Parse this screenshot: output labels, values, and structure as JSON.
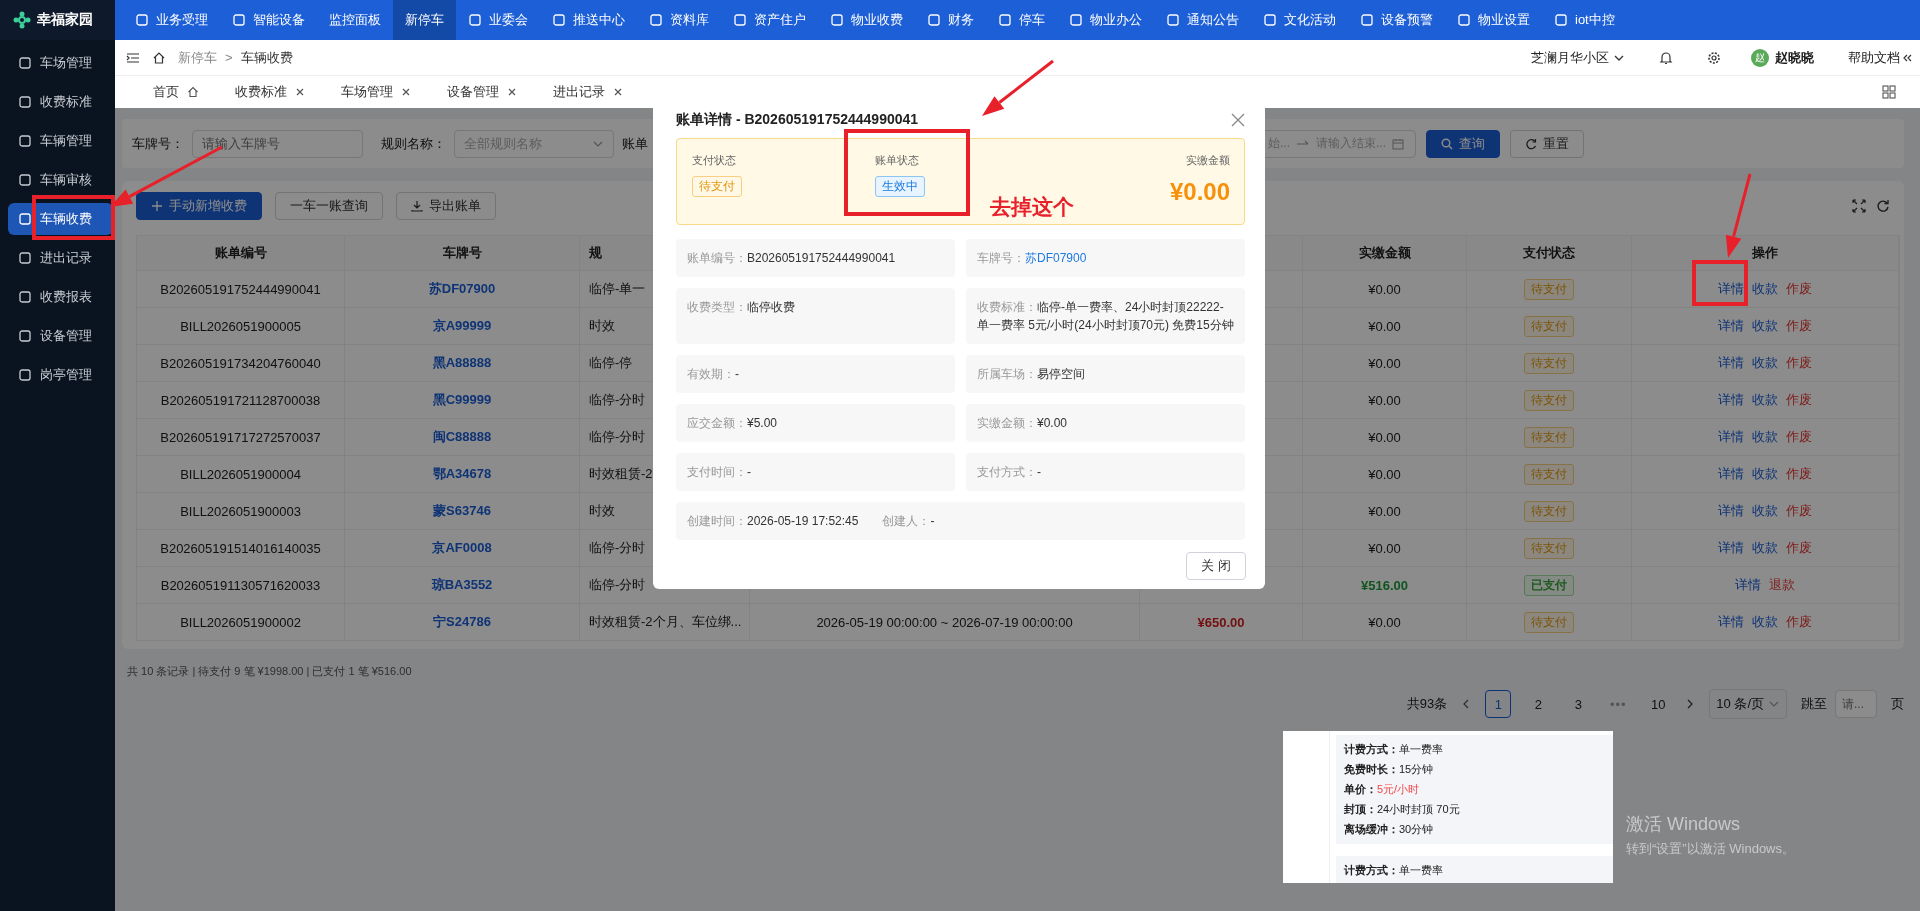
{
  "topbar": {
    "logo": "幸福家园",
    "nav": [
      {
        "label": "业务受理",
        "icon": true,
        "selected": false
      },
      {
        "label": "智能设备",
        "icon": true,
        "selected": false
      },
      {
        "label": "监控面板",
        "icon": false,
        "selected": false
      },
      {
        "label": "新停车",
        "icon": false,
        "selected": true
      },
      {
        "label": "业委会",
        "icon": true,
        "selected": false
      },
      {
        "label": "推送中心",
        "icon": true,
        "selected": false
      },
      {
        "label": "资料库",
        "icon": true,
        "selected": false
      },
      {
        "label": "资产住户",
        "icon": true,
        "selected": false
      },
      {
        "label": "物业收费",
        "icon": true,
        "selected": false
      },
      {
        "label": "财务",
        "icon": true,
        "selected": false
      },
      {
        "label": "停车",
        "icon": true,
        "selected": false
      },
      {
        "label": "物业办公",
        "icon": true,
        "selected": false
      },
      {
        "label": "通知公告",
        "icon": true,
        "selected": false
      },
      {
        "label": "文化活动",
        "icon": true,
        "selected": false
      },
      {
        "label": "设备预警",
        "icon": true,
        "selected": false
      },
      {
        "label": "物业设置",
        "icon": true,
        "selected": false
      },
      {
        "label": "iot中控",
        "icon": true,
        "selected": false
      }
    ]
  },
  "sidebar": {
    "items": [
      {
        "label": "车场管理",
        "selected": false
      },
      {
        "label": "收费标准",
        "selected": false
      },
      {
        "label": "车辆管理",
        "selected": false
      },
      {
        "label": "车辆审核",
        "selected": false
      },
      {
        "label": "车辆收费",
        "selected": true
      },
      {
        "label": "进出记录",
        "selected": false
      },
      {
        "label": "收费报表",
        "selected": false
      },
      {
        "label": "设备管理",
        "selected": false
      },
      {
        "label": "岗亭管理",
        "selected": false
      }
    ]
  },
  "header": {
    "breadcrumb": [
      "新停车",
      "车辆收费"
    ],
    "separator": ">",
    "community": "芝澜月华小区",
    "avatar": "赵",
    "user": "赵晓晓",
    "help": "帮助文档"
  },
  "tabs": [
    {
      "label": "首页",
      "kind": "home"
    },
    {
      "label": "收费标准",
      "kind": "closable"
    },
    {
      "label": "车场管理",
      "kind": "closable"
    },
    {
      "label": "设备管理",
      "kind": "closable"
    },
    {
      "label": "进出记录",
      "kind": "closable"
    }
  ],
  "filters": {
    "fields": [
      {
        "label": "车牌号：",
        "placeholder": "请输入车牌号",
        "kind": "input"
      },
      {
        "label": "规则名称：",
        "placeholder": "全部规则名称",
        "kind": "select"
      },
      {
        "label": "账单",
        "kind": "label"
      }
    ],
    "date_range": {
      "start": "始...",
      "end": "请输入结束..."
    },
    "buttons": [
      {
        "label": "查询",
        "kind": "primary"
      },
      {
        "label": "重置",
        "kind": "default"
      }
    ]
  },
  "toolbar": {
    "buttons": [
      {
        "label": "手动新增收费",
        "kind": "add"
      },
      {
        "label": "一车一账查询",
        "kind": "query"
      },
      {
        "label": "导出账单",
        "kind": "export"
      }
    ]
  },
  "table": {
    "columns": [
      {
        "label": "账单编号",
        "covered": false
      },
      {
        "label": "车牌号",
        "covered": false
      },
      {
        "label": "规",
        "covered": false
      },
      {
        "label": "实缴金额",
        "covered": false
      },
      {
        "label": "支付状态",
        "covered": false
      },
      {
        "label": "操作",
        "covered": false
      }
    ],
    "rows": [
      {
        "bill_no": "B202605191752444990041",
        "plate": "苏DF07900",
        "rule": "临停-单一",
        "paid": {
          "value": "¥0.00",
          "kind": "normal"
        },
        "status": {
          "label": "待支付",
          "kind": "pending"
        },
        "actions": [
          {
            "label": "详情",
            "kind": "link"
          },
          {
            "label": "收款",
            "kind": "link"
          },
          {
            "label": "作废",
            "kind": "danger"
          }
        ]
      },
      {
        "bill_no": "BILL2026051900005",
        "plate": "京A99999",
        "rule": "时效",
        "paid": {
          "value": "¥0.00",
          "kind": "normal"
        },
        "status": {
          "label": "待支付",
          "kind": "pending"
        },
        "actions": [
          {
            "label": "详情",
            "kind": "link"
          },
          {
            "label": "收款",
            "kind": "link"
          },
          {
            "label": "作废",
            "kind": "danger"
          }
        ]
      },
      {
        "bill_no": "B202605191734204760040",
        "plate": "黑A88888",
        "rule": "临停-停",
        "paid": {
          "value": "¥0.00",
          "kind": "normal"
        },
        "status": {
          "label": "待支付",
          "kind": "pending"
        },
        "actions": [
          {
            "label": "详情",
            "kind": "link"
          },
          {
            "label": "收款",
            "kind": "link"
          },
          {
            "label": "作废",
            "kind": "danger"
          }
        ]
      },
      {
        "bill_no": "B202605191721128700038",
        "plate": "黑C99999",
        "rule": "临停-分时",
        "paid": {
          "value": "¥0.00",
          "kind": "normal"
        },
        "status": {
          "label": "待支付",
          "kind": "pending"
        },
        "actions": [
          {
            "label": "详情",
            "kind": "link"
          },
          {
            "label": "收款",
            "kind": "link"
          },
          {
            "label": "作废",
            "kind": "danger"
          }
        ]
      },
      {
        "bill_no": "B202605191717272570037",
        "plate": "闽C88888",
        "rule": "临停-分时",
        "paid": {
          "value": "¥0.00",
          "kind": "normal"
        },
        "status": {
          "label": "待支付",
          "kind": "pending"
        },
        "actions": [
          {
            "label": "详情",
            "kind": "link"
          },
          {
            "label": "收款",
            "kind": "link"
          },
          {
            "label": "作废",
            "kind": "danger"
          }
        ]
      },
      {
        "bill_no": "BILL2026051900004",
        "plate": "鄂A34678",
        "rule": "时效租赁-2",
        "paid": {
          "value": "¥0.00",
          "kind": "normal"
        },
        "status": {
          "label": "待支付",
          "kind": "pending"
        },
        "actions": [
          {
            "label": "详情",
            "kind": "link"
          },
          {
            "label": "收款",
            "kind": "link"
          },
          {
            "label": "作废",
            "kind": "danger"
          }
        ]
      },
      {
        "bill_no": "BILL2026051900003",
        "plate": "蒙S63746",
        "rule": "时效",
        "paid": {
          "value": "¥0.00",
          "kind": "normal"
        },
        "status": {
          "label": "待支付",
          "kind": "pending"
        },
        "actions": [
          {
            "label": "详情",
            "kind": "link"
          },
          {
            "label": "收款",
            "kind": "link"
          },
          {
            "label": "作废",
            "kind": "danger"
          }
        ]
      },
      {
        "bill_no": "B202605191514016140035",
        "plate": "京AF0008",
        "rule": "临停-分时",
        "paid": {
          "value": "¥0.00",
          "kind": "normal"
        },
        "status": {
          "label": "待支付",
          "kind": "pending"
        },
        "actions": [
          {
            "label": "详情",
            "kind": "link"
          },
          {
            "label": "收款",
            "kind": "link"
          },
          {
            "label": "作废",
            "kind": "danger"
          }
        ]
      },
      {
        "bill_no": "B202605191130571620033",
        "plate": "琼BA3552",
        "rule": "临停-分时",
        "paid": {
          "value": "¥516.00",
          "kind": "success"
        },
        "status": {
          "label": "已支付",
          "kind": "paid"
        },
        "actions": [
          {
            "label": "详情",
            "kind": "link"
          },
          {
            "label": "退款",
            "kind": "danger"
          }
        ]
      },
      {
        "bill_no": "BILL2026051900002",
        "plate": "宁S24786",
        "rule": "时效租赁-2个月、车位绑...",
        "period": "2026-05-19 00:00:00 ~ 2026-07-19 00:00:00",
        "due": {
          "value": "¥650.00",
          "kind": "danger"
        },
        "paid": {
          "value": "¥0.00",
          "kind": "normal"
        },
        "status": {
          "label": "待支付",
          "kind": "pending"
        },
        "actions": [
          {
            "label": "详情",
            "kind": "link"
          },
          {
            "label": "收款",
            "kind": "link"
          },
          {
            "label": "作废",
            "kind": "danger"
          }
        ]
      }
    ]
  },
  "summary": "共 10 条记录 | 待支付 9 笔 ¥1998.00 | 已支付 1 笔 ¥516.00",
  "pagination": {
    "total": "共93条",
    "pages": [
      {
        "label": "1",
        "kind": "page",
        "selected": true
      },
      {
        "label": "2",
        "kind": "page",
        "selected": false
      },
      {
        "label": "3",
        "kind": "page",
        "selected": false
      },
      {
        "label": "•••",
        "kind": "ellipsis"
      },
      {
        "label": "10",
        "kind": "page",
        "selected": false
      }
    ],
    "page_size": "10 条/页",
    "jump_label": "跳至",
    "jump_placeholder": "请...",
    "jump_suffix": "页"
  },
  "modal": {
    "title": "账单详情 - B202605191752444990041",
    "summary": [
      {
        "label": "支付状态",
        "kind": "warning-tag",
        "value": "待支付"
      },
      {
        "label": "账单状态",
        "kind": "info-tag",
        "value": "生效中"
      },
      {
        "label": "实缴金额",
        "kind": "amount",
        "value": "¥0.00"
      }
    ],
    "details": [
      {
        "kind": "half",
        "fields": [
          {
            "label": "账单编号：",
            "value": "B202605191752444990041",
            "kind": "text"
          }
        ]
      },
      {
        "kind": "half",
        "fields": [
          {
            "label": "车牌号：",
            "value": "苏DF07900",
            "kind": "link"
          }
        ]
      },
      {
        "kind": "half",
        "fields": [
          {
            "label": "收费类型：",
            "value": "临停收费",
            "kind": "text"
          }
        ]
      },
      {
        "kind": "half",
        "fields": [
          {
            "label": "收费标准：",
            "value": "临停-单一费率、24小时封顶22222-单一费率 5元/小时(24小时封顶70元) 免费15分钟",
            "kind": "text"
          }
        ]
      },
      {
        "kind": "half",
        "fields": [
          {
            "label": "有效期：",
            "value": "-",
            "kind": "text"
          }
        ]
      },
      {
        "kind": "half",
        "fields": [
          {
            "label": "所属车场：",
            "value": "易停空间",
            "kind": "text"
          }
        ]
      },
      {
        "kind": "half",
        "fields": [
          {
            "label": "应交金额：",
            "value": "¥5.00",
            "kind": "text"
          }
        ]
      },
      {
        "kind": "half",
        "fields": [
          {
            "label": "实缴金额：",
            "value": "¥0.00",
            "kind": "text"
          }
        ]
      },
      {
        "kind": "half",
        "fields": [
          {
            "label": "支付时间：",
            "value": "-",
            "kind": "text"
          }
        ]
      },
      {
        "kind": "half",
        "fields": [
          {
            "label": "支付方式：",
            "value": "-",
            "kind": "text"
          }
        ]
      },
      {
        "kind": "wide",
        "fields": [
          {
            "label": "创建时间：",
            "value": "2026-05-19 17:52:45",
            "kind": "text"
          },
          {
            "label": "创建人：",
            "value": "-",
            "kind": "text"
          }
        ]
      }
    ],
    "close_button": "关 闭"
  },
  "annotation": {
    "note": "去掉这个"
  },
  "pasted_image": {
    "cards": [
      {
        "lines": [
          {
            "label": "计费方式：",
            "value": "单一费率",
            "kind": "text"
          },
          {
            "label": "免费时长：",
            "value": "15分钟",
            "kind": "text"
          },
          {
            "label": "单价：",
            "value": "5元/小时",
            "kind": "highlight"
          },
          {
            "label": "封顶：",
            "value": "24小时封顶 70元",
            "kind": "text"
          },
          {
            "label": "离场缓冲：",
            "value": "30分钟",
            "kind": "text"
          }
        ]
      },
      {
        "lines": [
          {
            "label": "计费方式：",
            "value": "单一费率",
            "kind": "text"
          }
        ]
      }
    ]
  },
  "os_notice": {
    "title": "激活 Windows",
    "text": "转到“设置”以激活 Windows。"
  }
}
